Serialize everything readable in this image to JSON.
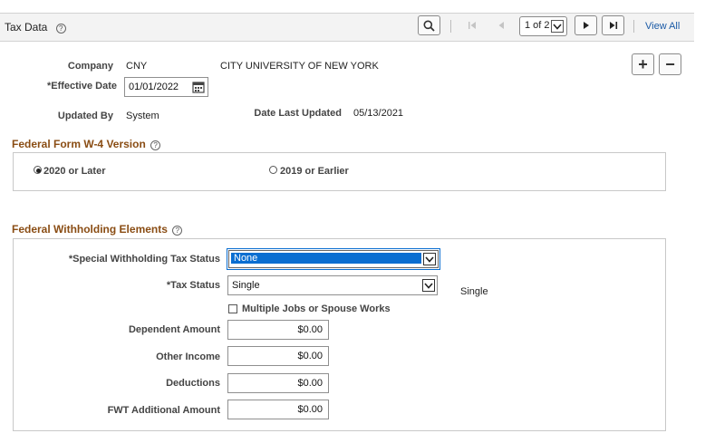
{
  "header": {
    "title": "Tax Data",
    "pager_text": "1 of 2",
    "view_all": "View All"
  },
  "company": {
    "label": "Company",
    "code": "CNY",
    "name": "CITY UNIVERSITY OF NEW YORK",
    "effective_date_label": "*Effective Date",
    "effective_date": "01/01/2022",
    "updated_by_label": "Updated By",
    "updated_by": "System",
    "date_last_updated_label": "Date Last Updated",
    "date_last_updated": "05/13/2021"
  },
  "w4_version": {
    "title": "Federal Form W-4 Version",
    "options": [
      {
        "label": "2020 or Later",
        "selected": true
      },
      {
        "label": "2019 or Earlier",
        "selected": false
      }
    ]
  },
  "withholding": {
    "title": "Federal Withholding Elements",
    "special_status_label": "*Special Withholding Tax Status",
    "special_status_value": "None",
    "tax_status_label": "*Tax Status",
    "tax_status_value": "Single",
    "tax_status_display": "Single",
    "multiple_jobs_label": "Multiple Jobs or Spouse Works",
    "multiple_jobs_checked": false,
    "fields": [
      {
        "label": "Dependent Amount",
        "value": "$0.00"
      },
      {
        "label": "Other Income",
        "value": "$0.00"
      },
      {
        "label": "Deductions",
        "value": "$0.00"
      },
      {
        "label": "FWT Additional Amount",
        "value": "$0.00"
      }
    ]
  },
  "icons": {
    "help": "?",
    "search": "search-icon",
    "add": "+",
    "remove": "−"
  },
  "colors": {
    "section_title": "#8a4d14",
    "link": "#1a5aa6",
    "highlight": "#0a6ed1"
  }
}
